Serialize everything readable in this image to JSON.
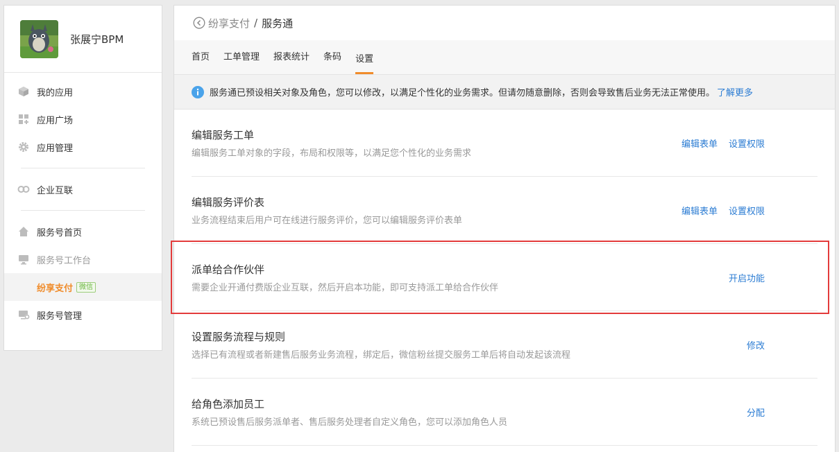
{
  "sidebar": {
    "profile_name": "张展宁BPM",
    "items": [
      {
        "label": "我的应用",
        "icon": "cube-icon"
      },
      {
        "label": "应用广场",
        "icon": "grid-plus-icon"
      },
      {
        "label": "应用管理",
        "icon": "gear-icon"
      },
      {
        "label": "企业互联",
        "icon": "link-icon"
      },
      {
        "label": "服务号首页",
        "icon": "home-icon"
      },
      {
        "label": "服务号工作台",
        "icon": "monitor-icon"
      },
      {
        "label": "纷享支付",
        "badge": "微信"
      },
      {
        "label": "服务号管理",
        "icon": "monitor-gear-icon"
      }
    ]
  },
  "breadcrumb": {
    "parent": "纷享支付",
    "separator": "/",
    "current": "服务通"
  },
  "tabs": [
    {
      "label": "首页"
    },
    {
      "label": "工单管理"
    },
    {
      "label": "报表统计"
    },
    {
      "label": "条码"
    },
    {
      "label": "设置"
    }
  ],
  "notice": {
    "text": "服务通已预设相关对象及角色，您可以修改，以满足个性化的业务需求。但请勿随意删除，否则会导致售后业务无法正常使用。",
    "link": "了解更多"
  },
  "settings": [
    {
      "title": "编辑服务工单",
      "desc": "编辑服务工单对象的字段，布局和权限等，以满足您个性化的业务需求",
      "actions": [
        "编辑表单",
        "设置权限"
      ]
    },
    {
      "title": "编辑服务评价表",
      "desc": "业务流程结束后用户可在线进行服务评价，您可以编辑服务评价表单",
      "actions": [
        "编辑表单",
        "设置权限"
      ]
    },
    {
      "title": "派单给合作伙伴",
      "desc": "需要企业开通付费版企业互联，然后开启本功能，即可支持派工单给合作伙伴",
      "actions": [
        "开启功能"
      ]
    },
    {
      "title": "设置服务流程与规则",
      "desc": "选择已有流程或者新建售后服务业务流程，绑定后，微信粉丝提交服务工单后将自动发起该流程",
      "actions": [
        "修改"
      ]
    },
    {
      "title": "给角色添加员工",
      "desc": "系统已预设售后服务派单者、售后服务处理者自定义角色，您可以添加角色人员",
      "actions": [
        "分配"
      ]
    }
  ],
  "colors": {
    "accent": "#f08c2b",
    "link": "#2b7cd3",
    "highlight": "#e33b3b",
    "wechat": "#6ab63f"
  }
}
